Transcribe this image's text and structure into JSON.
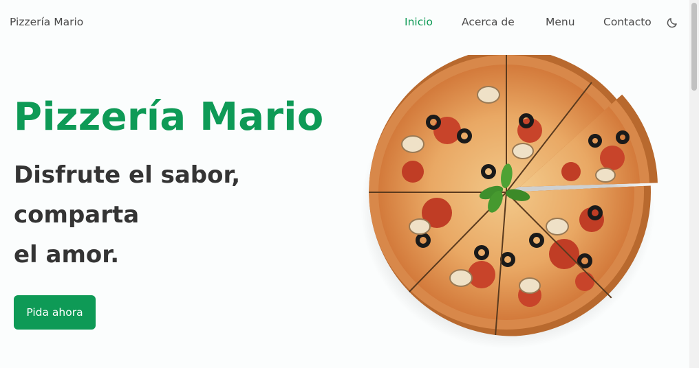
{
  "header": {
    "brand": "Pizzería Mario",
    "nav": [
      {
        "label": "Inicio",
        "active": true
      },
      {
        "label": "Acerca de",
        "active": false
      },
      {
        "label": "Menu",
        "active": false
      },
      {
        "label": "Contacto",
        "active": false
      }
    ],
    "theme_icon": "moon-icon"
  },
  "hero": {
    "title": "Pizzería Mario",
    "tagline": [
      "Disfrute el sabor,",
      "comparta",
      "el amor."
    ],
    "cta_label": "Pida ahora",
    "image": "pizza-image"
  },
  "colors": {
    "accent": "#0e9a56",
    "text": "#343434",
    "nav_text": "#4b4b4b",
    "background": "#fbfdfd"
  }
}
